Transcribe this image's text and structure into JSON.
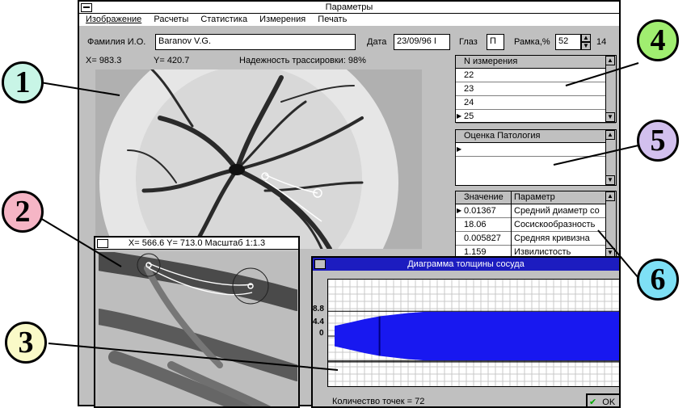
{
  "window": {
    "title": "Параметры"
  },
  "menu": {
    "items": [
      "Изображение",
      "Расчеты",
      "Статистика",
      "Измерения",
      "Печать"
    ]
  },
  "form": {
    "name_label": "Фамилия И.О.",
    "name_value": "Baranov V.G.",
    "date_label": "Дата",
    "date_value": "23/09/96 I",
    "eye_label": "Глаз",
    "eye_value": "П",
    "frame_label": "Рамка,%",
    "frame_value": "52",
    "frame_extra": "14"
  },
  "status": {
    "x": "X= 983.3",
    "y": "Y= 420.7",
    "reliability": "Надежность трассировки: 98%"
  },
  "measurements": {
    "header": "N измерения",
    "rows": [
      "22",
      "23",
      "24",
      "25"
    ]
  },
  "pathology": {
    "header": "Оценка Патология"
  },
  "params": {
    "headers": [
      "Значение",
      "Параметр"
    ],
    "rows": [
      {
        "value": "0.01367",
        "name": "Средний диаметр со"
      },
      {
        "value": "18.06",
        "name": "Сосискообразность"
      },
      {
        "value": "0.005827",
        "name": "Средняя кривизна"
      },
      {
        "value": "1.159",
        "name": "Извилистость"
      }
    ]
  },
  "zoom": {
    "title": "X= 566.6 Y= 713.0 Масштаб 1:1.3"
  },
  "chart": {
    "title": "Диаграмма толщины сосуда",
    "count_label": "Количество точек = 72",
    "ok_label": "OK"
  },
  "chart_data": {
    "type": "area",
    "title": "Диаграмма толщины сосуда",
    "ytick_labels": [
      "8.8",
      "4.4",
      "0"
    ],
    "series": [
      {
        "values": [
          1.8,
          2.4,
          3.0,
          3.5,
          3.8,
          4.1,
          4.3,
          4.3,
          4.3,
          4.3,
          4.3,
          4.3,
          4.3,
          4.3,
          4.3,
          4.3,
          4.3,
          4.3,
          4.3,
          4.3
        ]
      }
    ],
    "grid": true
  },
  "callouts": [
    "1",
    "2",
    "3",
    "4",
    "5",
    "6"
  ],
  "colors": {
    "callout1": "#c8f5e6",
    "callout2": "#f5b5c5",
    "callout3": "#fafac8",
    "callout4": "#a0ee70",
    "callout5": "#d2c0ee",
    "callout6": "#7ee0f5",
    "chart_fill": "#1818f0"
  }
}
